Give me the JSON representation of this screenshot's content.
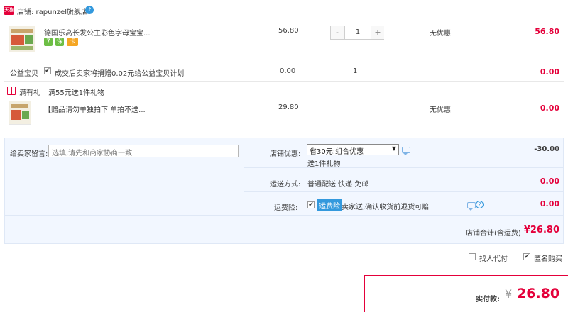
{
  "shop": {
    "tmall_badge": "天猫",
    "name": "店铺: rapunzel旗舰店",
    "help_icon": "help-bubble-icon"
  },
  "item1": {
    "title": "德国乐高长发公主彩色字母宝宝...",
    "price": "56.80",
    "qty": "1",
    "qty_minus": "-",
    "qty_plus": "+",
    "discount": "无优惠",
    "subtotal": "56.80",
    "badges": [
      "7",
      "保",
      "卡"
    ]
  },
  "charity": {
    "label": "公益宝贝",
    "desc": "成交后卖家将捐赠0.02元给公益宝贝计划",
    "price": "0.00",
    "qty": "1",
    "subtotal": "0.00",
    "checked": "✔"
  },
  "gift_header": {
    "label": "满有礼",
    "desc": "满55元送1件礼物"
  },
  "item2": {
    "title": "【赠品请勿单独拍下 单拍不送...",
    "price": "29.80",
    "discount": "无优惠",
    "subtotal": "0.00"
  },
  "message": {
    "label": "给卖家留言:",
    "placeholder": "选填,请先和商家协商一致"
  },
  "promo": {
    "label": "店铺优惠:",
    "selected": "省30元:组合优惠",
    "note": "送1件礼物",
    "amount": "-30.00"
  },
  "shipping": {
    "label": "运送方式:",
    "value": "普通配送 快递 免邮",
    "amount": "0.00"
  },
  "insurance": {
    "label": "运费险:",
    "tag": "运费险",
    "desc": "卖家送,确认收货前退货可赔",
    "amount": "0.00",
    "checked": "✔"
  },
  "shop_total": {
    "label": "店铺合计(含运费)",
    "value": "¥26.80"
  },
  "options": {
    "proxy_pay": "找人代付",
    "anonymous": "匿名购买",
    "anonymous_checked": "✔"
  },
  "payment": {
    "label": "实付款:",
    "currency": "¥",
    "value": "26.80"
  },
  "colors": {
    "accent_red": "#e4003a",
    "panel_bg": "#f2f7ff",
    "tmall_red": "#e4003a",
    "info_blue": "#3399dd"
  }
}
